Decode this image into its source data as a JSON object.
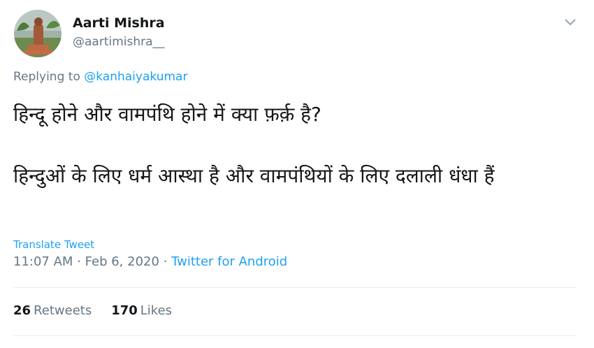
{
  "author": {
    "name": "Aarti Mishra",
    "handle": "@aartimishra__"
  },
  "reply": {
    "prefix": "Replying to",
    "mention": "@kanhaiyakumar"
  },
  "tweet": {
    "line1": "हिन्दू होने और वामपंथि होने में क्या फ़र्क़ है?",
    "line2": "हिन्दुओं के लिए धर्म आस्था है और वामपंथियों के लिए दलाली धंधा हैं"
  },
  "translate_label": "Translate Tweet",
  "meta": {
    "time": "11:07 AM",
    "separator": " · ",
    "date": "Feb 6, 2020",
    "source": "Twitter for Android"
  },
  "stats": {
    "retweets_count": "26",
    "retweets_label": "Retweets",
    "likes_count": "170",
    "likes_label": "Likes"
  },
  "icons": {
    "menu": "chevron-down-icon"
  },
  "colors": {
    "link": "#1da1f2",
    "secondary": "#657786",
    "primary": "#14171a",
    "divider": "#e6ecf0"
  }
}
